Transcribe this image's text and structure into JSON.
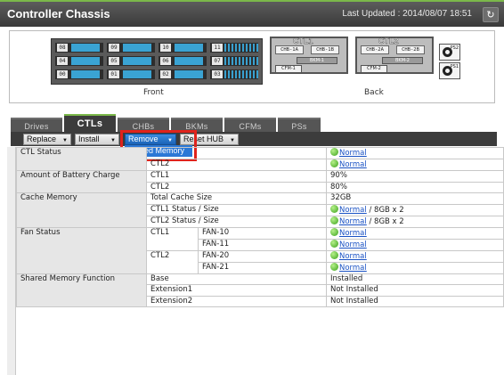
{
  "window": {
    "title": "Controller Chassis",
    "last_updated_label": "Last Updated : 2014/08/07 18:51",
    "refresh_icon": "refresh-icon"
  },
  "chassis": {
    "front_label": "Front",
    "back_label": "Back",
    "front_slots": [
      [
        "08",
        "09",
        "10",
        "11"
      ],
      [
        "04",
        "05",
        "06",
        "07"
      ],
      [
        "00",
        "01",
        "02",
        "03"
      ]
    ],
    "back": {
      "ctl1_label": "CTL1",
      "ctl2_label": "CTL2",
      "ctl1_chbs": [
        "CHB-1A",
        "CHB-1B"
      ],
      "ctl2_chbs": [
        "CHB-2A",
        "CHB-2B"
      ],
      "ctl1_bkm": "BKM-1",
      "ctl2_bkm": "BKM-2",
      "ctl1_cfm": "CFM-1",
      "ctl2_cfm": "CFM-2",
      "ps1": "PS1",
      "ps2": "PS2"
    }
  },
  "tabs": [
    {
      "label": "Drives"
    },
    {
      "label": "CTLs"
    },
    {
      "label": "CHBs"
    },
    {
      "label": "BKMs"
    },
    {
      "label": "CFMs"
    },
    {
      "label": "PSs"
    }
  ],
  "toolbar": {
    "replace": "Replace",
    "install": "Install",
    "remove": "Remove",
    "reset_hub": "Reset HUB",
    "remove_menu_item": "Shared Memory"
  },
  "table": {
    "ctl_status": {
      "label": "CTL Status",
      "ctl2": "CTL2",
      "ctl1_value": "Normal",
      "ctl2_value": "Normal"
    },
    "battery": {
      "label": "Amount of Battery Charge",
      "ctl1": "CTL1",
      "ctl2": "CTL2",
      "ctl1_value": "90%",
      "ctl2_value": "80%"
    },
    "cache": {
      "label": "Cache Memory",
      "total_label": "Total Cache Size",
      "total_value": "32GB",
      "ctl1_label": "CTL1 Status / Size",
      "ctl1_status": "Normal",
      "ctl1_size": " / 8GB x 2",
      "ctl2_label": "CTL2 Status / Size",
      "ctl2_status": "Normal",
      "ctl2_size": " / 8GB x 2"
    },
    "fan": {
      "label": "Fan Status",
      "ctl1": "CTL1",
      "ctl2": "CTL2",
      "fans": [
        {
          "name": "FAN-10",
          "status": "Normal"
        },
        {
          "name": "FAN-11",
          "status": "Normal"
        },
        {
          "name": "FAN-20",
          "status": "Normal"
        },
        {
          "name": "FAN-21",
          "status": "Normal"
        }
      ]
    },
    "shared": {
      "label": "Shared Memory Function",
      "rows": [
        {
          "name": "Base",
          "value": "Installed"
        },
        {
          "name": "Extension1",
          "value": "Not Installed"
        },
        {
          "name": "Extension2",
          "value": "Not Installed"
        }
      ]
    }
  },
  "colors": {
    "accent_green": "#7bb84a",
    "highlight_red": "#e0231c",
    "selection_blue": "#2b78d6",
    "link_blue": "#1a52c4"
  }
}
